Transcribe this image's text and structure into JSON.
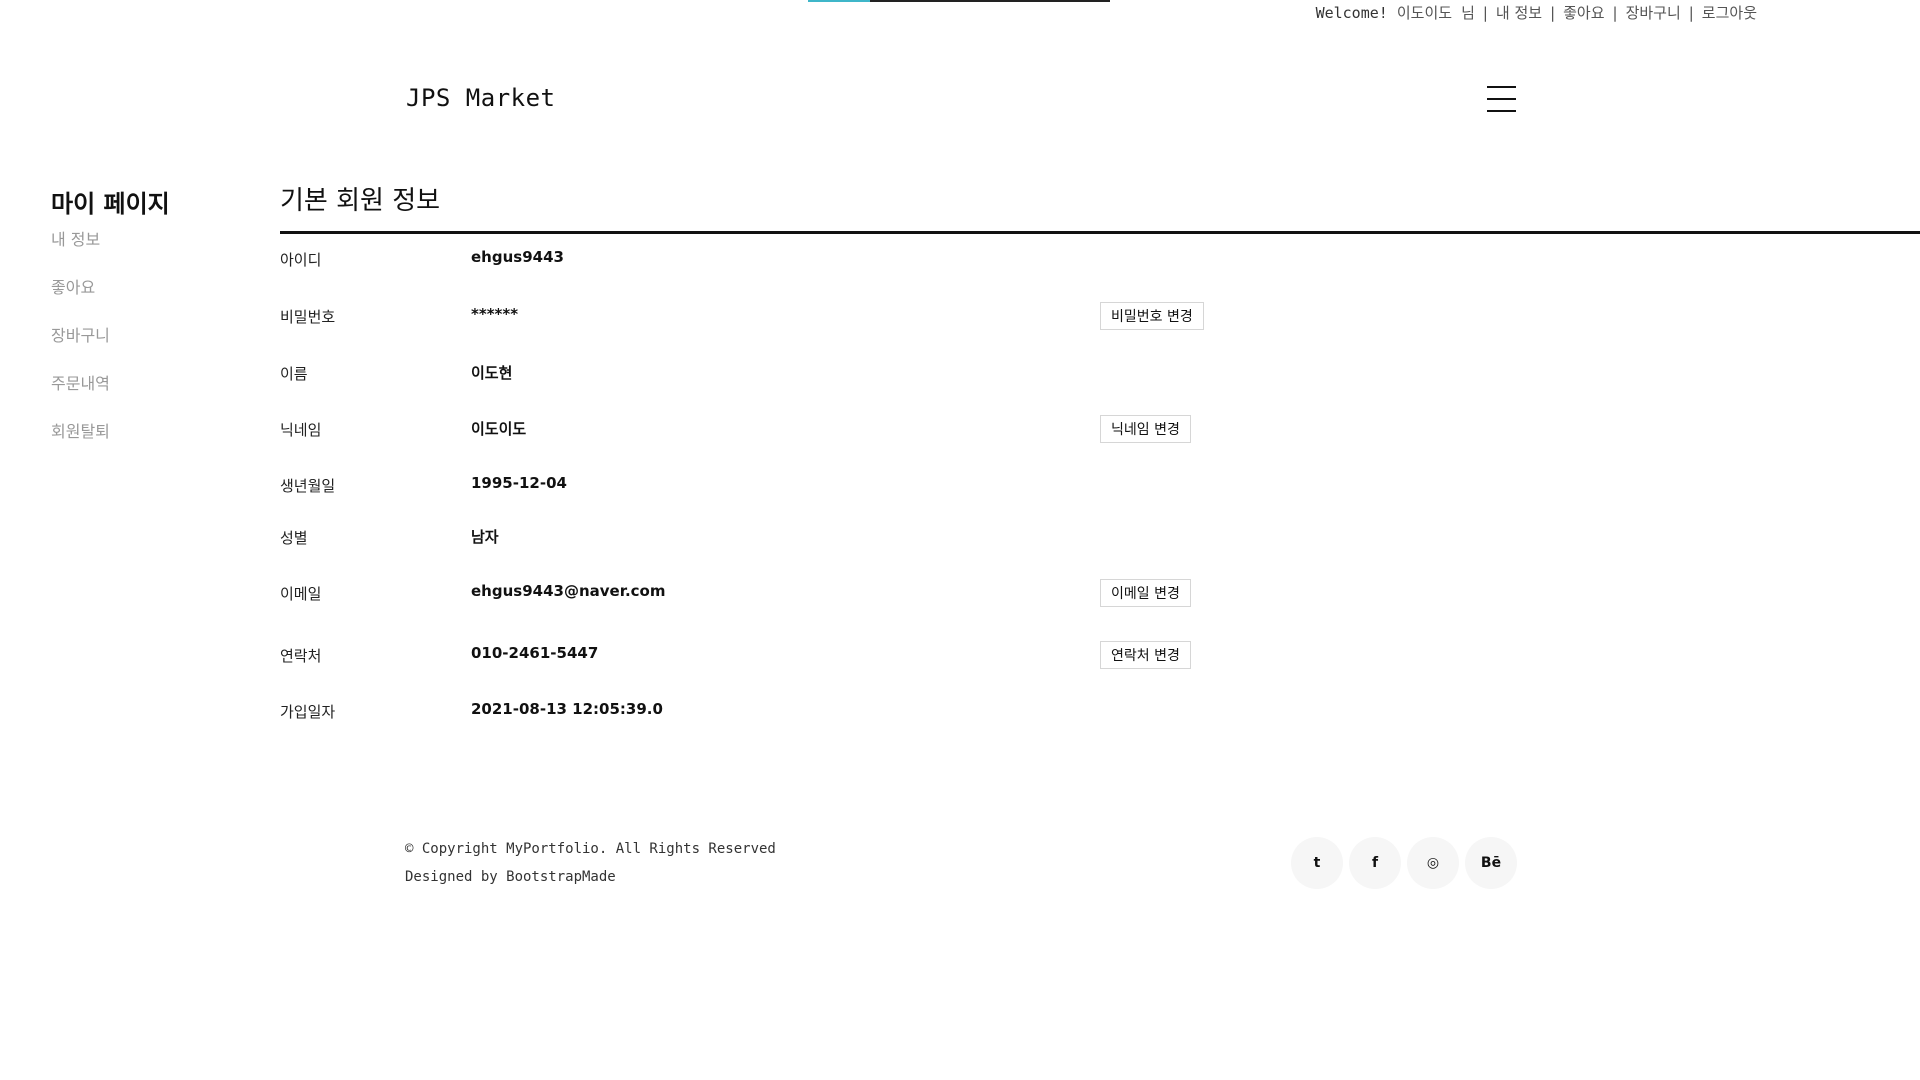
{
  "topbar": {
    "welcome": "Welcome!",
    "nickname": "이도이도",
    "honorific": "님",
    "links": [
      "내 정보",
      "좋아요",
      "장바구니",
      "로그아웃"
    ],
    "separator": "|"
  },
  "brand": "JPS Market",
  "sidebar": {
    "title": "마이 페이지",
    "items": [
      "내 정보",
      "좋아요",
      "장바구니",
      "주문내역",
      "회원탈퇴"
    ]
  },
  "section": {
    "title": "기본 회원 정보",
    "rows": [
      {
        "label": "아이디",
        "value": "ehgus9443",
        "button": ""
      },
      {
        "label": "비밀번호",
        "value": "******",
        "button": "비밀번호 변경"
      },
      {
        "label": "이름",
        "value": "이도현",
        "button": ""
      },
      {
        "label": "닉네임",
        "value": "이도이도",
        "button": "닉네임 변경"
      },
      {
        "label": "생년월일",
        "value": "1995-12-04",
        "button": ""
      },
      {
        "label": "성별",
        "value": "남자",
        "button": ""
      },
      {
        "label": "이메일",
        "value": "ehgus9443@naver.com",
        "button": "이메일 변경"
      },
      {
        "label": "연락처",
        "value": "010-2461-5447",
        "button": "연락처 변경"
      },
      {
        "label": "가입일자",
        "value": "2021-08-13 12:05:39.0",
        "button": ""
      }
    ]
  },
  "footer": {
    "copyright": "© Copyright MyPortfolio. All Rights Reserved",
    "designed": "Designed by BootstrapMade",
    "social": [
      {
        "icon": "twitter-icon",
        "glyph": "t"
      },
      {
        "icon": "facebook-icon",
        "glyph": "f"
      },
      {
        "icon": "dribbble-icon",
        "glyph": "◎"
      },
      {
        "icon": "behance-icon",
        "glyph": "Bē"
      }
    ]
  },
  "colors": {
    "accent": "#3fb6c9",
    "text": "#111111",
    "muted": "#999999"
  }
}
